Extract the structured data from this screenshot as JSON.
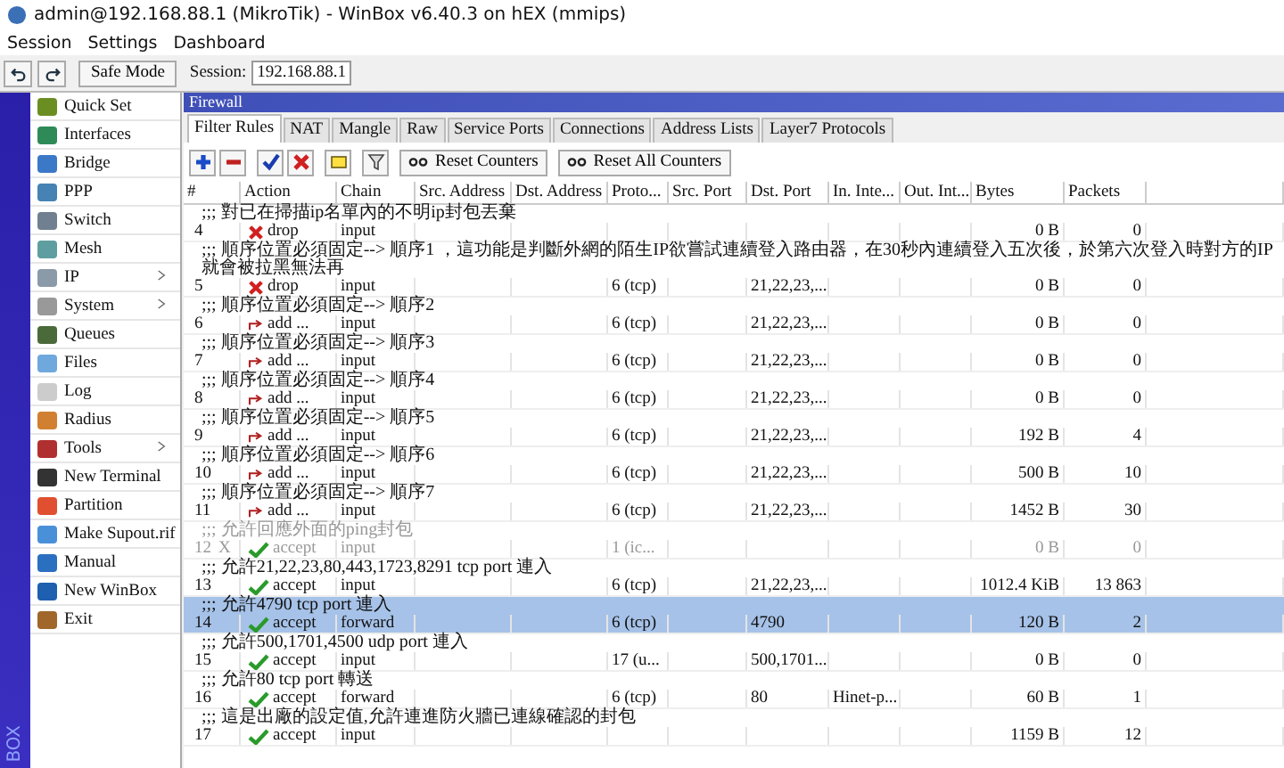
{
  "window": {
    "title": "admin@192.168.88.1 (MikroTik) - WinBox v6.40.3 on hEX (mmips)"
  },
  "menu": [
    "Session",
    "Settings",
    "Dashboard"
  ],
  "toolbar": {
    "safe_mode": "Safe Mode",
    "session_label": "Session:",
    "session_value": "192.168.88.1"
  },
  "sidebar": {
    "brand": "BOX",
    "items": [
      {
        "label": "Quick Set",
        "submenu": false
      },
      {
        "label": "Interfaces",
        "submenu": false
      },
      {
        "label": "Bridge",
        "submenu": false
      },
      {
        "label": "PPP",
        "submenu": false
      },
      {
        "label": "Switch",
        "submenu": false
      },
      {
        "label": "Mesh",
        "submenu": false
      },
      {
        "label": "IP",
        "submenu": true
      },
      {
        "label": "System",
        "submenu": true
      },
      {
        "label": "Queues",
        "submenu": false
      },
      {
        "label": "Files",
        "submenu": false
      },
      {
        "label": "Log",
        "submenu": false
      },
      {
        "label": "Radius",
        "submenu": false
      },
      {
        "label": "Tools",
        "submenu": true
      },
      {
        "label": "New Terminal",
        "submenu": false
      },
      {
        "label": "Partition",
        "submenu": false
      },
      {
        "label": "Make Supout.rif",
        "submenu": false
      },
      {
        "label": "Manual",
        "submenu": false
      },
      {
        "label": "New WinBox",
        "submenu": false
      },
      {
        "label": "Exit",
        "submenu": false
      }
    ]
  },
  "firewall": {
    "title": "Firewall",
    "tabs": [
      {
        "label": "Filter Rules",
        "selected": true
      },
      {
        "label": "NAT",
        "selected": false
      },
      {
        "label": "Mangle",
        "selected": false
      },
      {
        "label": "Raw",
        "selected": false
      },
      {
        "label": "Service Ports",
        "selected": false
      },
      {
        "label": "Connections",
        "selected": false
      },
      {
        "label": "Address Lists",
        "selected": false
      },
      {
        "label": "Layer7 Protocols",
        "selected": false
      }
    ],
    "buttons": [
      "Reset Counters",
      "Reset All Counters"
    ],
    "columns": [
      "#",
      "Action",
      "Chain",
      "Src. Address",
      "Dst. Address",
      "Proto...",
      "Src. Port",
      "Dst. Port",
      "In. Inte...",
      "Out. Int...",
      "Bytes",
      "Packets"
    ],
    "rules": [
      {
        "comment": ";;; 對已在掃描ip名單內的不明ip封包丟棄",
        "number": "4",
        "kind": "drop",
        "action": "drop",
        "chain": "input",
        "bytes": "0 B",
        "packets": "0",
        "selected": false,
        "disabled": false
      },
      {
        "comment": ";;; 順序位置必須固定--> 順序1 ，這功能是判斷外網的陌生IP欲嘗試連續登入路由器，在30秒內連續登入五次後，於第六次登入時對方的IP就會被拉黑無法再",
        "number": "5",
        "kind": "drop",
        "action": "drop",
        "chain": "input",
        "protocol": "6 (tcp)",
        "dst_port": "21,22,23,...",
        "bytes": "0 B",
        "packets": "0",
        "selected": false,
        "disabled": false
      },
      {
        "comment": ";;; 順序位置必須固定--> 順序2",
        "number": "6",
        "kind": "add",
        "action": "add ...",
        "chain": "input",
        "protocol": "6 (tcp)",
        "dst_port": "21,22,23,...",
        "bytes": "0 B",
        "packets": "0",
        "selected": false,
        "disabled": false
      },
      {
        "comment": ";;; 順序位置必須固定--> 順序3",
        "number": "7",
        "kind": "add",
        "action": "add ...",
        "chain": "input",
        "protocol": "6 (tcp)",
        "dst_port": "21,22,23,...",
        "bytes": "0 B",
        "packets": "0",
        "selected": false,
        "disabled": false
      },
      {
        "comment": ";;; 順序位置必須固定--> 順序4",
        "number": "8",
        "kind": "add",
        "action": "add ...",
        "chain": "input",
        "protocol": "6 (tcp)",
        "dst_port": "21,22,23,...",
        "bytes": "0 B",
        "packets": "0",
        "selected": false,
        "disabled": false
      },
      {
        "comment": ";;; 順序位置必須固定--> 順序5",
        "number": "9",
        "kind": "add",
        "action": "add ...",
        "chain": "input",
        "protocol": "6 (tcp)",
        "dst_port": "21,22,23,...",
        "bytes": "192 B",
        "packets": "4",
        "selected": false,
        "disabled": false
      },
      {
        "comment": ";;; 順序位置必須固定--> 順序6",
        "number": "10",
        "kind": "add",
        "action": "add ...",
        "chain": "input",
        "protocol": "6 (tcp)",
        "dst_port": "21,22,23,...",
        "bytes": "500 B",
        "packets": "10",
        "selected": false,
        "disabled": false
      },
      {
        "comment": ";;; 順序位置必須固定--> 順序7",
        "number": "11",
        "kind": "add",
        "action": "add ...",
        "chain": "input",
        "protocol": "6 (tcp)",
        "dst_port": "21,22,23,...",
        "bytes": "1452 B",
        "packets": "30",
        "selected": false,
        "disabled": false
      },
      {
        "comment": ";;; 允許回應外面的ping封包",
        "number": "12",
        "flag": "X",
        "kind": "accept",
        "action": "accept",
        "chain": "input",
        "protocol": "1 (ic...",
        "bytes": "0 B",
        "packets": "0",
        "selected": false,
        "disabled": true
      },
      {
        "comment": ";;; 允許21,22,23,80,443,1723,8291 tcp port 連入",
        "number": "13",
        "kind": "accept",
        "action": "accept",
        "chain": "input",
        "protocol": "6 (tcp)",
        "dst_port": "21,22,23,...",
        "bytes": "1012.4 KiB",
        "packets": "13 863",
        "selected": false,
        "disabled": false
      },
      {
        "comment": ";;; 允許4790 tcp port 連入",
        "number": "14",
        "kind": "accept",
        "action": "accept",
        "chain": "forward",
        "protocol": "6 (tcp)",
        "dst_port": "4790",
        "bytes": "120 B",
        "packets": "2",
        "selected": true,
        "disabled": false
      },
      {
        "comment": ";;; 允許500,1701,4500 udp port 連入",
        "number": "15",
        "kind": "accept",
        "action": "accept",
        "chain": "input",
        "protocol": "17 (u...",
        "dst_port": "500,1701...",
        "bytes": "0 B",
        "packets": "0",
        "selected": false,
        "disabled": false
      },
      {
        "comment": ";;; 允許80 tcp port 轉送",
        "number": "16",
        "kind": "accept",
        "action": "accept",
        "chain": "forward",
        "protocol": "6 (tcp)",
        "dst_port": "80",
        "in_interface": "Hinet-p...",
        "bytes": "60 B",
        "packets": "1",
        "selected": false,
        "disabled": false
      },
      {
        "comment": ";;; 這是出廠的設定值,允許連進防火牆已連線確認的封包",
        "number": "17",
        "kind": "accept",
        "action": "accept",
        "chain": "input",
        "bytes": "1159 B",
        "packets": "12",
        "selected": false,
        "disabled": false
      }
    ]
  }
}
